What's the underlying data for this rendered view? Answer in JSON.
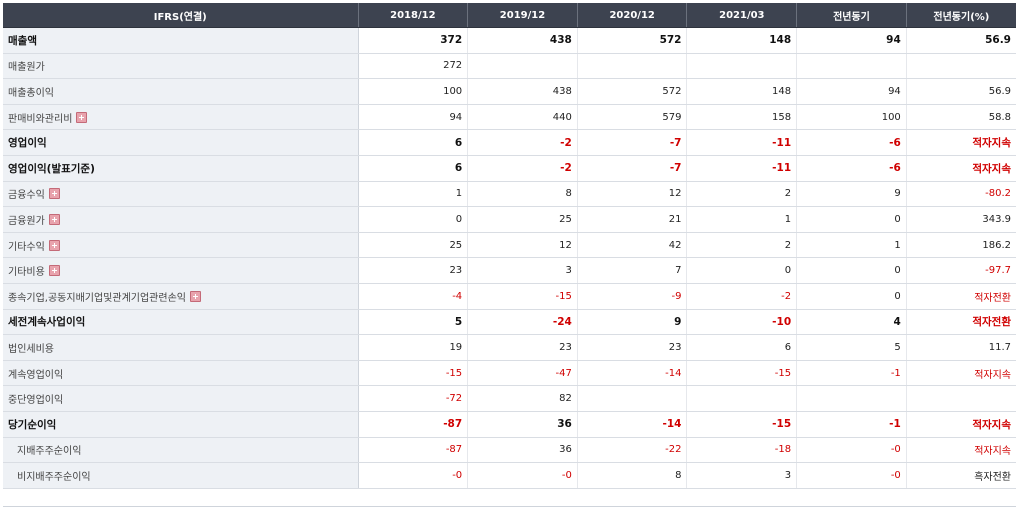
{
  "headers": [
    "IFRS(연결)",
    "2018/12",
    "2019/12",
    "2020/12",
    "2021/03",
    "전년동기",
    "전년동기(%)"
  ],
  "rows": [
    {
      "label": "매출액",
      "major": true,
      "expand": false,
      "values": [
        "372",
        "438",
        "572",
        "148",
        "94",
        "56.9"
      ]
    },
    {
      "label": "매출원가",
      "major": false,
      "expand": false,
      "values": [
        "272",
        "",
        "",
        "",
        "",
        ""
      ]
    },
    {
      "label": "매출총이익",
      "major": false,
      "expand": false,
      "values": [
        "100",
        "438",
        "572",
        "148",
        "94",
        "56.9"
      ]
    },
    {
      "label": "판매비와관리비",
      "major": false,
      "expand": true,
      "values": [
        "94",
        "440",
        "579",
        "158",
        "100",
        "58.8"
      ]
    },
    {
      "label": "영업이익",
      "major": true,
      "expand": false,
      "values": [
        "6",
        "-2",
        "-7",
        "-11",
        "-6",
        "적자지속"
      ]
    },
    {
      "label": "영업이익(발표기준)",
      "major": true,
      "expand": false,
      "values": [
        "6",
        "-2",
        "-7",
        "-11",
        "-6",
        "적자지속"
      ]
    },
    {
      "label": "금융수익",
      "major": false,
      "expand": true,
      "values": [
        "1",
        "8",
        "12",
        "2",
        "9",
        "-80.2"
      ]
    },
    {
      "label": "금융원가",
      "major": false,
      "expand": true,
      "values": [
        "0",
        "25",
        "21",
        "1",
        "0",
        "343.9"
      ]
    },
    {
      "label": "기타수익",
      "major": false,
      "expand": true,
      "values": [
        "25",
        "12",
        "42",
        "2",
        "1",
        "186.2"
      ]
    },
    {
      "label": "기타비용",
      "major": false,
      "expand": true,
      "values": [
        "23",
        "3",
        "7",
        "0",
        "0",
        "-97.7"
      ]
    },
    {
      "label": "종속기업,공동지배기업및관계기업관련손익",
      "major": false,
      "expand": true,
      "values": [
        "-4",
        "-15",
        "-9",
        "-2",
        "0",
        "적자전환"
      ]
    },
    {
      "label": "세전계속사업이익",
      "major": true,
      "expand": false,
      "values": [
        "5",
        "-24",
        "9",
        "-10",
        "4",
        "적자전환"
      ]
    },
    {
      "label": "법인세비용",
      "major": false,
      "expand": false,
      "values": [
        "19",
        "23",
        "23",
        "6",
        "5",
        "11.7"
      ]
    },
    {
      "label": "계속영업이익",
      "major": false,
      "expand": false,
      "values": [
        "-15",
        "-47",
        "-14",
        "-15",
        "-1",
        "적자지속"
      ]
    },
    {
      "label": "중단영업이익",
      "major": false,
      "expand": false,
      "values": [
        "-72",
        "82",
        "",
        "",
        "",
        ""
      ]
    },
    {
      "label": "당기순이익",
      "major": true,
      "expand": false,
      "values": [
        "-87",
        "36",
        "-14",
        "-15",
        "-1",
        "적자지속"
      ]
    },
    {
      "label": "지배주주순이익",
      "major": false,
      "expand": false,
      "sub": true,
      "values": [
        "-87",
        "36",
        "-22",
        "-18",
        "-0",
        "적자지속"
      ]
    },
    {
      "label": "비지배주주순이익",
      "major": false,
      "expand": false,
      "sub": true,
      "values": [
        "-0",
        "-0",
        "8",
        "3",
        "-0",
        "흑자전환"
      ]
    }
  ]
}
